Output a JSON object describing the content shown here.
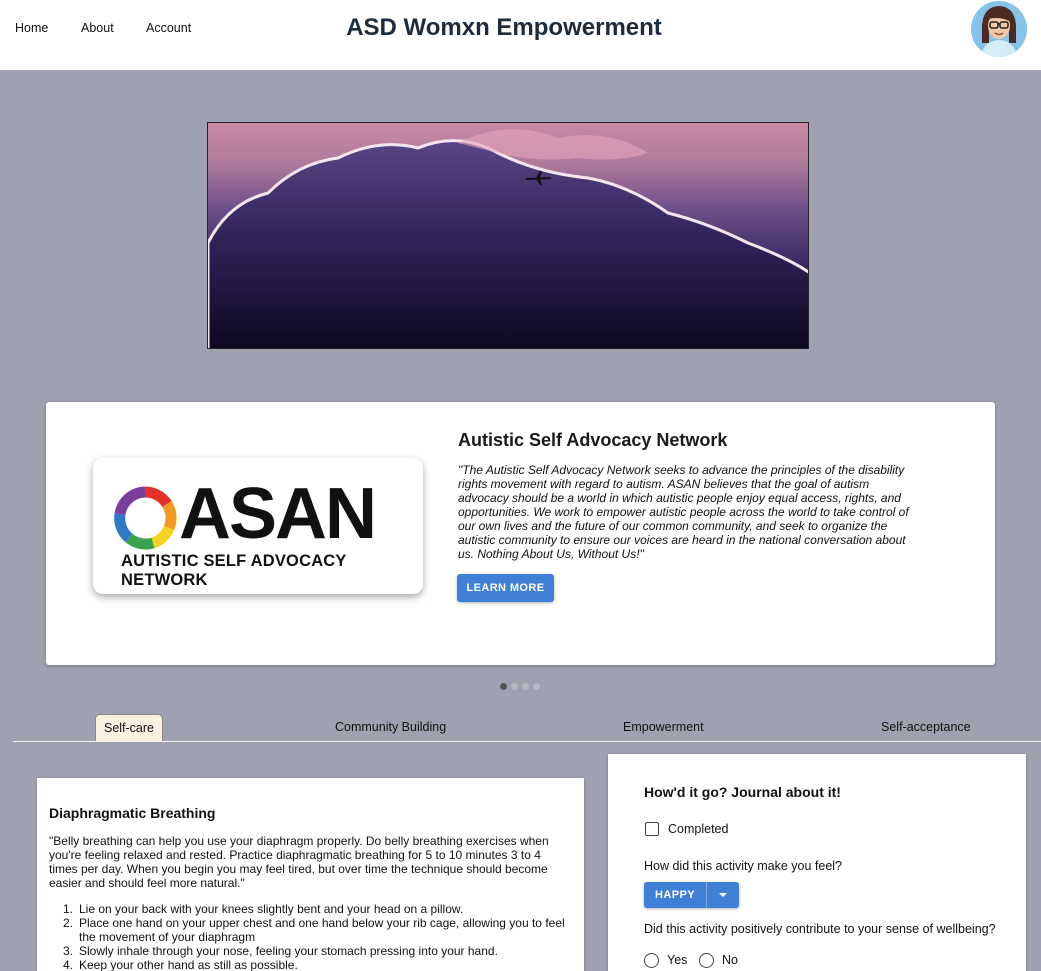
{
  "header": {
    "nav": [
      "Home",
      "About",
      "Account"
    ],
    "title": "ASD Womxn Empowerment"
  },
  "carousel": {
    "logo_word": "ASAN",
    "logo_subtitle": "AUTISTIC SELF ADVOCACY NETWORK",
    "org_title": "Autistic Self Advocacy Network",
    "quote": "\"The Autistic Self Advocacy Network seeks to advance the principles of the disability rights movement with regard to autism. ASAN believes that the goal of autism advocacy should be a world in which autistic people enjoy equal access, rights, and opportunities. We work to empower autistic people across the world to take control of our own lives and the future of our common community, and seek to organize the autistic community to ensure our voices are heard in the national conversation about us. Nothing About Us, Without Us!\"",
    "button_label": "LEARN MORE",
    "slide_count": 4,
    "active_slide": 1
  },
  "tabs": [
    "Self-care",
    "Community Building",
    "Empowerment",
    "Self-acceptance"
  ],
  "activity": {
    "title": "Diaphragmatic Breathing",
    "description": "\"Belly breathing can help you use your diaphragm properly. Do belly breathing exercises when you're feeling relaxed and rested. Practice diaphragmatic breathing for 5 to 10 minutes 3 to 4 times per day. When you begin you may feel tired, but over time the technique should become easier and should feel more natural.\"",
    "steps": [
      "Lie on your back with your knees slightly bent and your head on a pillow.",
      "Place one hand on your upper chest and one hand below your rib cage, allowing you to feel the movement of your diaphragm",
      "Slowly inhale through your nose, feeling your stomach pressing into your hand.",
      "Keep your other hand as still as possible."
    ]
  },
  "journal": {
    "title": "How'd it go? Journal about it!",
    "completed_label": "Completed",
    "feel_question": "How did this activity make you feel?",
    "feel_value": "HAPPY",
    "wellbeing_question": "Did this activity positively contribute to your sense of wellbeing?",
    "yes_label": "Yes",
    "no_label": "No"
  },
  "colors": {
    "page_bg": "#9fa0b0",
    "button_blue": "#3f7fd6",
    "active_tab_bg": "#fbefe0"
  }
}
